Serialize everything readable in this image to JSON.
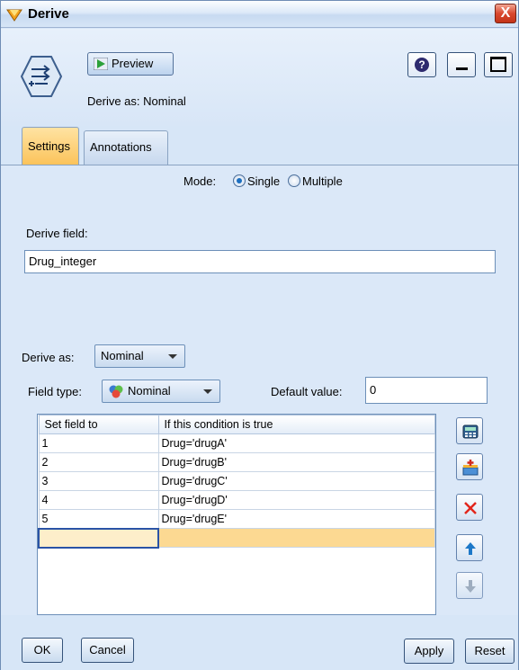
{
  "window": {
    "title": "Derive",
    "close_symbol": "X"
  },
  "header": {
    "preview_label": "Preview",
    "derive_as_caption": "Derive as: Nominal"
  },
  "tabs": [
    {
      "label": "Settings",
      "active": true
    },
    {
      "label": "Annotations",
      "active": false
    }
  ],
  "settings": {
    "mode_label": "Mode:",
    "mode_options": [
      "Single",
      "Multiple"
    ],
    "mode_selected": "Single",
    "derive_field_label": "Derive field:",
    "derive_field_value": "Drug_integer",
    "derive_as_label": "Derive as:",
    "derive_as_value": "Nominal",
    "field_type_label": "Field type:",
    "field_type_value": "Nominal",
    "default_value_label": "Default value:",
    "default_value": "0"
  },
  "table": {
    "columns": [
      "Set field to",
      "If this condition is true"
    ],
    "rows": [
      {
        "set": "1",
        "condition": "Drug='drugA'"
      },
      {
        "set": "2",
        "condition": "Drug='drugB'"
      },
      {
        "set": "3",
        "condition": "Drug='drugC'"
      },
      {
        "set": "4",
        "condition": "Drug='drugD'"
      },
      {
        "set": "5",
        "condition": "Drug='drugE'"
      }
    ]
  },
  "footer": {
    "ok": "OK",
    "cancel": "Cancel",
    "apply": "Apply",
    "reset": "Reset"
  },
  "colors": {
    "active_tab": "#fbc35b",
    "panel": "#dbe8f8",
    "selected_row": "#fcd992"
  }
}
